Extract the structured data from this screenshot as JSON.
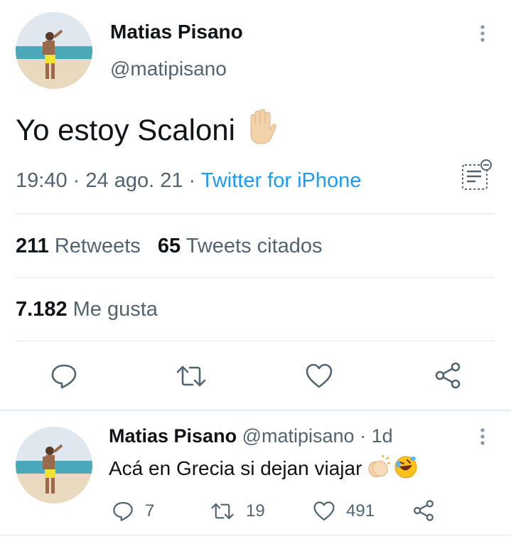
{
  "main_tweet": {
    "author_name": "Matias Pisano",
    "author_handle": "@matipisano",
    "text": "Yo estoy Scaloni",
    "time": "19:40",
    "separator": "·",
    "date": "24 ago. 21",
    "source": "Twitter for iPhone",
    "retweets_count": "211",
    "retweets_label": "Retweets",
    "quotes_count": "65",
    "quotes_label": "Tweets citados",
    "likes_count": "7.182",
    "likes_label": "Me gusta"
  },
  "reply_tweet": {
    "author_name": "Matias Pisano",
    "author_handle": "@matipisano",
    "separator": "·",
    "age": "1d",
    "text": "Acá en Grecia si dejan viajar",
    "reply_count": "7",
    "retweet_count": "19",
    "like_count": "491"
  },
  "icons": {
    "more": "more-vertical-icon",
    "translate": "text-options-icon",
    "reply": "reply-icon",
    "retweet": "retweet-icon",
    "like": "heart-icon",
    "share": "share-icon",
    "raised_hand": "raised-hand-emoji",
    "clapping": "clapping-hands-emoji",
    "laughing": "rolling-laughing-emoji"
  },
  "colors": {
    "text": "#0f1419",
    "secondary": "#536471",
    "link": "#1d9bf0",
    "divider": "#e1e8ed"
  }
}
